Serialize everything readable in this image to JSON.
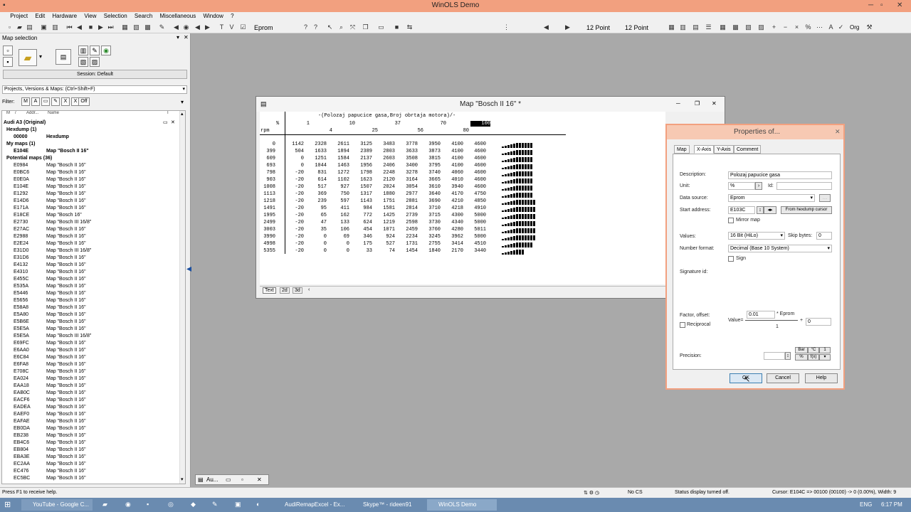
{
  "window": {
    "title": "WinOLS Demo"
  },
  "menu": [
    "Project",
    "Edit",
    "Hardware",
    "View",
    "Selection",
    "Search",
    "Miscellaneous",
    "Window",
    "?"
  ],
  "toolbar": {
    "eprom": "Eprom",
    "point1": "12 Point",
    "point2": "12 Point",
    "org": "Org"
  },
  "left": {
    "title": "Map selection",
    "session": "Session: Default",
    "dropdown": "Projects, Versions & Maps: (Ctrl+Shift+F)",
    "filter": "Filter:",
    "off": "Off",
    "col_m": "M",
    "col_slash": "/",
    "col_addr": "Addr...",
    "col_name": "Name",
    "col_i": "I"
  },
  "tree": [
    {
      "a": "Audi A3 (Original)",
      "n": "",
      "b": true,
      "i": 0
    },
    {
      "a": "Hexdump (1)",
      "n": "",
      "b": true,
      "i": 1
    },
    {
      "a": "00000",
      "n": "Hexdump",
      "b": true,
      "i": 2
    },
    {
      "a": "My maps (1)",
      "n": "",
      "b": true,
      "i": 1
    },
    {
      "a": "E104E",
      "n": "Map \"Bosch II 16\"",
      "b": true,
      "i": 2
    },
    {
      "a": "Potential maps (36)",
      "n": "",
      "b": true,
      "i": 1
    }
  ],
  "maps": [
    [
      "E0984",
      "Map \"Bosch II 16\""
    ],
    [
      "E0BC6",
      "Map \"Bosch II 16\""
    ],
    [
      "E0E0A",
      "Map \"Bosch II 16\""
    ],
    [
      "E104E",
      "Map \"Bosch II 16\""
    ],
    [
      "E1292",
      "Map \"Bosch II 16\""
    ],
    [
      "E14D6",
      "Map \"Bosch II 16\""
    ],
    [
      "E171A",
      "Map \"Bosch II 16\""
    ],
    [
      "E18CE",
      "Map \"Bosch 16\""
    ],
    [
      "E2730",
      "Map \"Bosch III 16/8\""
    ],
    [
      "E27AC",
      "Map \"Bosch II 16\""
    ],
    [
      "E2988",
      "Map \"Bosch II 16\""
    ],
    [
      "E2E24",
      "Map \"Bosch II 16\""
    ],
    [
      "E31D0",
      "Map \"Bosch III 16/8\""
    ],
    [
      "E31D6",
      "Map \"Bosch II 16\""
    ],
    [
      "E4132",
      "Map \"Bosch II 16\""
    ],
    [
      "E4310",
      "Map \"Bosch II 16\""
    ],
    [
      "E455C",
      "Map \"Bosch II 16\""
    ],
    [
      "E535A",
      "Map \"Bosch II 16\""
    ],
    [
      "E5446",
      "Map \"Bosch II 16\""
    ],
    [
      "E5656",
      "Map \"Bosch II 16\""
    ],
    [
      "E58A8",
      "Map \"Bosch II 16\""
    ],
    [
      "E5A80",
      "Map \"Bosch II 16\""
    ],
    [
      "E5B6E",
      "Map \"Bosch II 16\""
    ],
    [
      "E5E5A",
      "Map \"Bosch II 16\""
    ],
    [
      "E5E5A",
      "Map \"Bosch III 16/8\""
    ],
    [
      "E69FC",
      "Map \"Bosch II 16\""
    ],
    [
      "E6AA0",
      "Map \"Bosch II 16\""
    ],
    [
      "E6C84",
      "Map \"Bosch II 16\""
    ],
    [
      "E6FA8",
      "Map \"Bosch II 16\""
    ],
    [
      "E708C",
      "Map \"Bosch II 16\""
    ],
    [
      "EA024",
      "Map \"Bosch II 16\""
    ],
    [
      "EAA18",
      "Map \"Bosch II 16\""
    ],
    [
      "EAB0C",
      "Map \"Bosch II 16\""
    ],
    [
      "EACF6",
      "Map \"Bosch II 16\""
    ],
    [
      "EADEA",
      "Map \"Bosch II 16\""
    ],
    [
      "EAEF0",
      "Map \"Bosch II 16\""
    ],
    [
      "EAFAE",
      "Map \"Bosch II 16\""
    ],
    [
      "EB0DA",
      "Map \"Bosch II 16\""
    ],
    [
      "EB238",
      "Map \"Bosch II 16\""
    ],
    [
      "EB4C6",
      "Map \"Bosch II 16\""
    ],
    [
      "EB804",
      "Map \"Bosch II 16\""
    ],
    [
      "EBA3E",
      "Map \"Bosch II 16\""
    ],
    [
      "EC2AA",
      "Map \"Bosch II 16\""
    ],
    [
      "EC476",
      "Map \"Bosch II 16\""
    ],
    [
      "EC5BC",
      "Map \"Bosch II 16\""
    ]
  ],
  "mapwin": {
    "title": "Map \"Bosch II 16\" *",
    "header": "-(Polozaj papucice gasa,Broj obrtaja motora)/-",
    "pct": "%",
    "rpm": "rpm",
    "xtop": [
      "1",
      "10",
      "37",
      "70",
      "100"
    ],
    "xbot": [
      "4",
      "25",
      "56",
      "80"
    ],
    "rows": [
      [
        "0",
        "1142",
        "2328",
        "2611",
        "3125",
        "3483",
        "3778",
        "3950",
        "4100",
        "4600"
      ],
      [
        "399",
        "504",
        "1633",
        "1894",
        "2389",
        "2803",
        "3633",
        "3873",
        "4100",
        "4600"
      ],
      [
        "609",
        "0",
        "1251",
        "1584",
        "2137",
        "2603",
        "3508",
        "3815",
        "4100",
        "4600"
      ],
      [
        "693",
        "0",
        "1044",
        "1463",
        "1956",
        "2406",
        "3400",
        "3795",
        "4100",
        "4600"
      ],
      [
        "798",
        "-20",
        "831",
        "1272",
        "1798",
        "2248",
        "3278",
        "3740",
        "4060",
        "4600"
      ],
      [
        "903",
        "-20",
        "614",
        "1102",
        "1623",
        "2120",
        "3164",
        "3665",
        "4010",
        "4600"
      ],
      [
        "1008",
        "-20",
        "517",
        "927",
        "1507",
        "2024",
        "3054",
        "3610",
        "3940",
        "4600"
      ],
      [
        "1113",
        "-20",
        "369",
        "750",
        "1317",
        "1880",
        "2977",
        "3640",
        "4170",
        "4750"
      ],
      [
        "1218",
        "-20",
        "239",
        "597",
        "1143",
        "1751",
        "2881",
        "3690",
        "4210",
        "4850"
      ],
      [
        "1491",
        "-20",
        "95",
        "411",
        "984",
        "1581",
        "2814",
        "3710",
        "4218",
        "4910"
      ],
      [
        "1995",
        "-20",
        "65",
        "162",
        "772",
        "1425",
        "2739",
        "3715",
        "4300",
        "5000"
      ],
      [
        "2499",
        "-20",
        "47",
        "133",
        "624",
        "1219",
        "2598",
        "3730",
        "4340",
        "5000"
      ],
      [
        "3003",
        "-20",
        "35",
        "106",
        "454",
        "1071",
        "2459",
        "3760",
        "4280",
        "5011"
      ],
      [
        "3990",
        "-20",
        "0",
        "69",
        "346",
        "924",
        "2234",
        "3245",
        "3962",
        "5000"
      ],
      [
        "4998",
        "-20",
        "0",
        "0",
        "175",
        "527",
        "1731",
        "2755",
        "3414",
        "4510"
      ],
      [
        "5355",
        "-20",
        "0",
        "0",
        "33",
        "74",
        "1454",
        "1840",
        "2170",
        "3440"
      ]
    ],
    "tabs": [
      "Text",
      "2d",
      "3d"
    ]
  },
  "props": {
    "title": "Properties of...",
    "tabs": [
      "Map",
      "X-Axis",
      "Y-Axis",
      "Comment"
    ],
    "desc_l": "Description:",
    "desc": "Polozaj papucice gasa",
    "unit_l": "Unit:",
    "unit": "%",
    "id_l": "Id:",
    "src_l": "Data source:",
    "src": "Eprom",
    "start_l": "Start address:",
    "start": "E103C",
    "fromhex": "From hexdump cursor",
    "mirror": "Mirror map",
    "values_l": "Values:",
    "values": "16 Bit (HiLo)",
    "skip_l": "Skip bytes:",
    "skip": "0",
    "numfmt_l": "Number format:",
    "numfmt": "Decimal        (Base 10 System)",
    "sign": "Sign",
    "sigid_l": "Signature id:",
    "factor_l": "Factor, offset:",
    "recip": "Reciprocal",
    "value_l": "Value=",
    "factor": "0.01",
    "eprom": "* Eprom",
    "plus": "+",
    "offset": "0",
    "one": "1",
    "prec_l": "Precision:",
    "bar": "Bar",
    "degc": "°C",
    "btn1": "1",
    "pct": "%",
    "fx": "f(x)",
    "ok": "OK",
    "cancel": "Cancel",
    "help": "Help"
  },
  "minwin": {
    "label": "Au..."
  },
  "status": {
    "help": "Press F1 to receive help.",
    "nocs": "No CS",
    "disp": "Status display turned off.",
    "cursor": "Cursor: E104C => 00100 (00100) -> 0 (0.00%), Width: 9"
  },
  "taskbar": [
    "YouTube - Google C...",
    "AudiRemapExcel - Ex...",
    "Skype™ - rideen91",
    "WinOLS Demo"
  ],
  "clock": {
    "lang": "ENG",
    "time": "6:17 PM"
  }
}
